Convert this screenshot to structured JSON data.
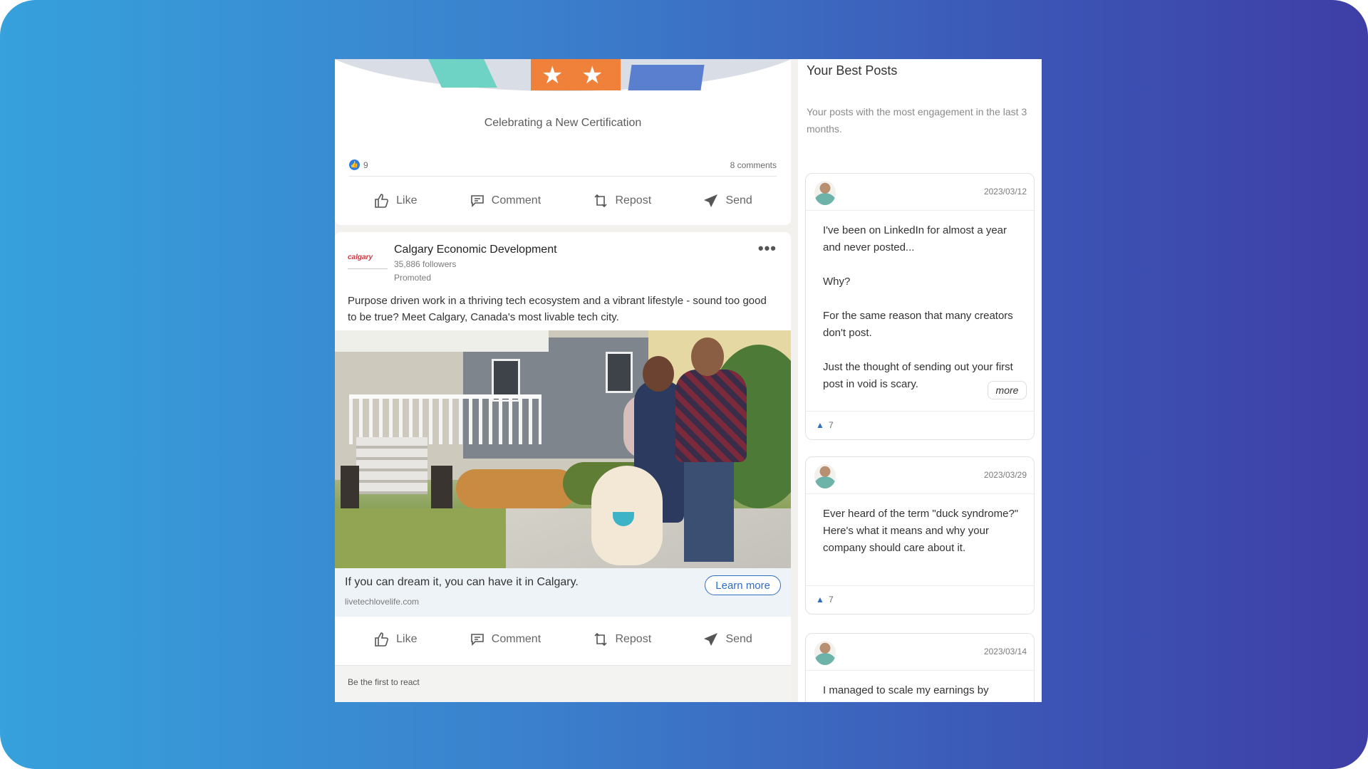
{
  "feed": {
    "cert_post": {
      "title": "Celebrating a New Certification",
      "reaction_count": "9",
      "comments": "8 comments"
    },
    "actions": {
      "like": "Like",
      "comment": "Comment",
      "repost": "Repost",
      "send": "Send"
    },
    "ad_post": {
      "logo_text": "calgary",
      "company": "Calgary Economic Development",
      "followers": "35,886 followers",
      "promoted": "Promoted",
      "text": "Purpose driven work in a thriving tech ecosystem and a vibrant lifestyle - sound too good to be true? Meet Calgary, Canada's most livable tech city.",
      "cta_headline": "If you can dream it, you can have it in Calgary.",
      "cta_domain": "livetechlovelife.com",
      "cta_button": "Learn more",
      "first_react": "Be the first to react"
    }
  },
  "panel": {
    "title": "Your Best Posts",
    "subtitle": "Your posts with the most engagement in the last 3 months.",
    "posts": [
      {
        "date": "2023/03/12",
        "paragraphs": [
          "I've been on LinkedIn for almost a year and never posted...",
          "Why?",
          "For the same reason that many creators don't post.",
          "Just the thought of sending out your first post in void is scary."
        ],
        "more": "more",
        "likes": "7"
      },
      {
        "date": "2023/03/29",
        "paragraphs": [
          "Ever heard of the term \"duck syndrome?\" Here's what it means and why your company should care about it."
        ],
        "likes": "7"
      },
      {
        "date": "2023/03/14",
        "paragraphs": [
          "I managed to scale my earnings by"
        ]
      }
    ]
  },
  "colors": {
    "background_start": "#36a1dc",
    "background_end": "#3e3ea6",
    "link_blue": "#2f6ec2"
  },
  "icons": [
    "like-icon",
    "comment-icon",
    "repost-icon",
    "send-icon",
    "thumbs-up-icon",
    "more-dots-icon"
  ]
}
